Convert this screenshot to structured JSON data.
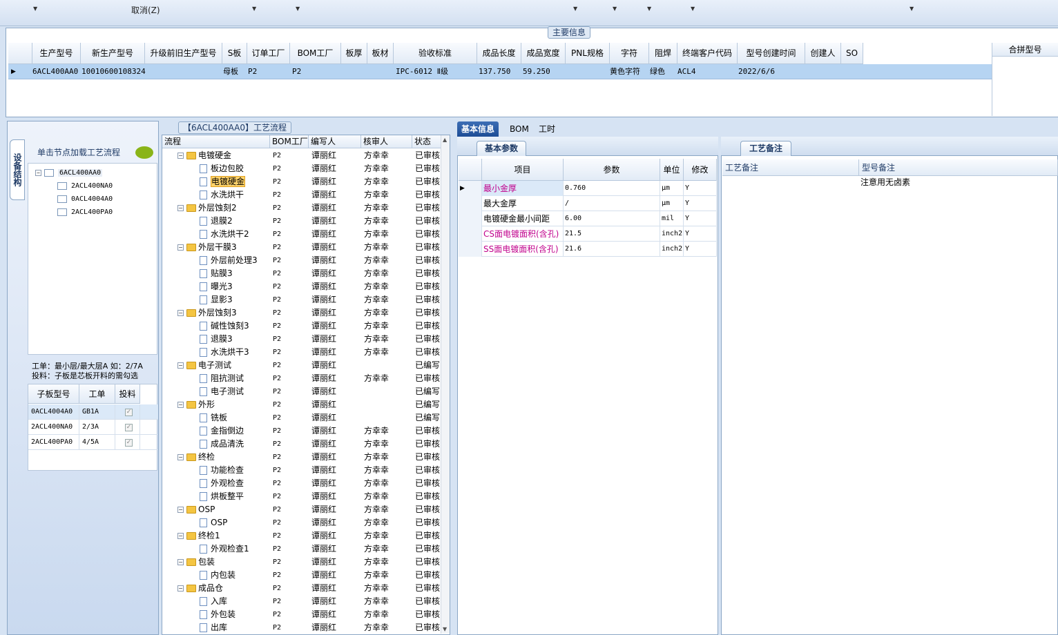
{
  "toolbar": {
    "cancel_label": "取消(Z)"
  },
  "main_info": {
    "title": "主要信息",
    "columns": [
      "生产型号",
      "新生产型号",
      "升级前旧生产型号",
      "S板",
      "订单工厂",
      "BOM工厂",
      "板厚",
      "板材",
      "验收标准",
      "成品长度",
      "成品宽度",
      "PNL规格",
      "字符",
      "阻焊",
      "终端客户代码",
      "型号创建时间",
      "创建人",
      "SO"
    ],
    "row": {
      "model": "6ACL400AA0",
      "new_model": "10010600108324",
      "s_board": "母板",
      "order_factory": "P2",
      "bom_factory": "P2",
      "standard": "IPC-6012 Ⅱ级",
      "length": "137.750",
      "width": "59.250",
      "char": "黄色字符",
      "mask": "绿色",
      "customer": "ACL4",
      "created": "2022/6/6"
    },
    "merge_header": "合拼型号"
  },
  "left": {
    "vtab": "设备结构",
    "hint": "单击节点加载工艺流程",
    "tree": [
      "6ACL400AA0",
      "2ACL400NA0",
      "0ACL4004A0",
      "2ACL400PA0"
    ],
    "note_line1": "工单：最小层/最大层A 如：2/7A",
    "note_line2": "投料：子板是芯板开料的需勾选",
    "sub_columns": [
      "子板型号",
      "工单",
      "投料"
    ],
    "sub_rows": [
      {
        "model": "0ACL4004A0",
        "order": "GB1A"
      },
      {
        "model": "2ACL400NA0",
        "order": "2/3A"
      },
      {
        "model": "2ACL400PA0",
        "order": "4/5A"
      }
    ]
  },
  "process": {
    "title": "【6ACL400AA0】工艺流程",
    "columns": [
      "流程",
      "BOM工厂",
      "编写人",
      "核审人",
      "状态"
    ],
    "rows": [
      {
        "name": "电镀硬金",
        "folder": true,
        "f": "P2",
        "w": "谭丽红",
        "r": "方幸幸",
        "s": "已审核"
      },
      {
        "name": "板边包胶",
        "folder": false,
        "f": "P2",
        "w": "谭丽红",
        "r": "方幸幸",
        "s": "已审核"
      },
      {
        "name": "电镀硬金",
        "folder": false,
        "f": "P2",
        "w": "谭丽红",
        "r": "方幸幸",
        "s": "已审核",
        "sel": true
      },
      {
        "name": "水洗烘干",
        "folder": false,
        "f": "P2",
        "w": "谭丽红",
        "r": "方幸幸",
        "s": "已审核"
      },
      {
        "name": "外层蚀刻2",
        "folder": true,
        "f": "P2",
        "w": "谭丽红",
        "r": "方幸幸",
        "s": "已审核"
      },
      {
        "name": "退膜2",
        "folder": false,
        "f": "P2",
        "w": "谭丽红",
        "r": "方幸幸",
        "s": "已审核"
      },
      {
        "name": "水洗烘干2",
        "folder": false,
        "f": "P2",
        "w": "谭丽红",
        "r": "方幸幸",
        "s": "已审核"
      },
      {
        "name": "外层干膜3",
        "folder": true,
        "f": "P2",
        "w": "谭丽红",
        "r": "方幸幸",
        "s": "已审核"
      },
      {
        "name": "外层前处理3",
        "folder": false,
        "f": "P2",
        "w": "谭丽红",
        "r": "方幸幸",
        "s": "已审核"
      },
      {
        "name": "贴膜3",
        "folder": false,
        "f": "P2",
        "w": "谭丽红",
        "r": "方幸幸",
        "s": "已审核"
      },
      {
        "name": "曝光3",
        "folder": false,
        "f": "P2",
        "w": "谭丽红",
        "r": "方幸幸",
        "s": "已审核"
      },
      {
        "name": "显影3",
        "folder": false,
        "f": "P2",
        "w": "谭丽红",
        "r": "方幸幸",
        "s": "已审核"
      },
      {
        "name": "外层蚀刻3",
        "folder": true,
        "f": "P2",
        "w": "谭丽红",
        "r": "方幸幸",
        "s": "已审核"
      },
      {
        "name": "碱性蚀刻3",
        "folder": false,
        "f": "P2",
        "w": "谭丽红",
        "r": "方幸幸",
        "s": "已审核"
      },
      {
        "name": "退膜3",
        "folder": false,
        "f": "P2",
        "w": "谭丽红",
        "r": "方幸幸",
        "s": "已审核"
      },
      {
        "name": "水洗烘干3",
        "folder": false,
        "f": "P2",
        "w": "谭丽红",
        "r": "方幸幸",
        "s": "已审核"
      },
      {
        "name": "电子测试",
        "folder": true,
        "f": "P2",
        "w": "谭丽红",
        "r": "",
        "s": "已编写"
      },
      {
        "name": "阻抗测试",
        "folder": false,
        "f": "P2",
        "w": "谭丽红",
        "r": "方幸幸",
        "s": "已审核"
      },
      {
        "name": "电子测试",
        "folder": false,
        "f": "P2",
        "w": "谭丽红",
        "r": "",
        "s": "已编写"
      },
      {
        "name": "外形",
        "folder": true,
        "f": "P2",
        "w": "谭丽红",
        "r": "",
        "s": "已编写"
      },
      {
        "name": "铣板",
        "folder": false,
        "f": "P2",
        "w": "谭丽红",
        "r": "",
        "s": "已编写"
      },
      {
        "name": "金指倒边",
        "folder": false,
        "f": "P2",
        "w": "谭丽红",
        "r": "方幸幸",
        "s": "已审核"
      },
      {
        "name": "成品清洗",
        "folder": false,
        "f": "P2",
        "w": "谭丽红",
        "r": "方幸幸",
        "s": "已审核"
      },
      {
        "name": "终检",
        "folder": true,
        "f": "P2",
        "w": "谭丽红",
        "r": "方幸幸",
        "s": "已审核"
      },
      {
        "name": "功能检查",
        "folder": false,
        "f": "P2",
        "w": "谭丽红",
        "r": "方幸幸",
        "s": "已审核"
      },
      {
        "name": "外观检查",
        "folder": false,
        "f": "P2",
        "w": "谭丽红",
        "r": "方幸幸",
        "s": "已审核"
      },
      {
        "name": "烘板整平",
        "folder": false,
        "f": "P2",
        "w": "谭丽红",
        "r": "方幸幸",
        "s": "已审核"
      },
      {
        "name": "OSP",
        "folder": true,
        "f": "P2",
        "w": "谭丽红",
        "r": "方幸幸",
        "s": "已审核"
      },
      {
        "name": "OSP",
        "folder": false,
        "f": "P2",
        "w": "谭丽红",
        "r": "方幸幸",
        "s": "已审核"
      },
      {
        "name": "终检1",
        "folder": true,
        "f": "P2",
        "w": "谭丽红",
        "r": "方幸幸",
        "s": "已审核"
      },
      {
        "name": "外观检查1",
        "folder": false,
        "f": "P2",
        "w": "谭丽红",
        "r": "方幸幸",
        "s": "已审核"
      },
      {
        "name": "包装",
        "folder": true,
        "f": "P2",
        "w": "谭丽红",
        "r": "方幸幸",
        "s": "已审核"
      },
      {
        "name": "内包装",
        "folder": false,
        "f": "P2",
        "w": "谭丽红",
        "r": "方幸幸",
        "s": "已审核"
      },
      {
        "name": "成品仓",
        "folder": true,
        "f": "P2",
        "w": "谭丽红",
        "r": "方幸幸",
        "s": "已审核"
      },
      {
        "name": "入库",
        "folder": false,
        "f": "P2",
        "w": "谭丽红",
        "r": "方幸幸",
        "s": "已审核"
      },
      {
        "name": "外包装",
        "folder": false,
        "f": "P2",
        "w": "谭丽红",
        "r": "方幸幸",
        "s": "已审核"
      },
      {
        "name": "出库",
        "folder": false,
        "f": "P2",
        "w": "谭丽红",
        "r": "方幸幸",
        "s": "已审核"
      }
    ]
  },
  "right": {
    "tabs": [
      "基本信息",
      "BOM",
      "工时"
    ],
    "basic_tab": "基本参数",
    "basic_columns": [
      "项目",
      "参数",
      "单位",
      "修改"
    ],
    "basic_rows": [
      {
        "item": "最小金厚",
        "value": "0.760",
        "unit": "μm",
        "mod": "Y",
        "pink": true
      },
      {
        "item": "最大金厚",
        "value": "/",
        "unit": "μm",
        "mod": "Y",
        "pink": false
      },
      {
        "item": "电镀硬金最小间距",
        "value": "6.00",
        "unit": "mil",
        "mod": "Y",
        "pink": false
      },
      {
        "item": "CS面电镀面积(含孔)",
        "value": "21.5",
        "unit": "inch2",
        "mod": "Y",
        "pink": true
      },
      {
        "item": "SS面电镀面积(含孔)",
        "value": "21.6",
        "unit": "inch2",
        "mod": "Y",
        "pink": true
      }
    ],
    "craft_tab": "工艺备注",
    "craft_columns": [
      "工艺备注",
      "型号备注"
    ],
    "model_note": "注意用无卤素"
  },
  "colors": {
    "accent": "#1d4d96",
    "selection": "#b6d4f2",
    "highlight": "#ffd36a",
    "pink": "#c0008c"
  }
}
